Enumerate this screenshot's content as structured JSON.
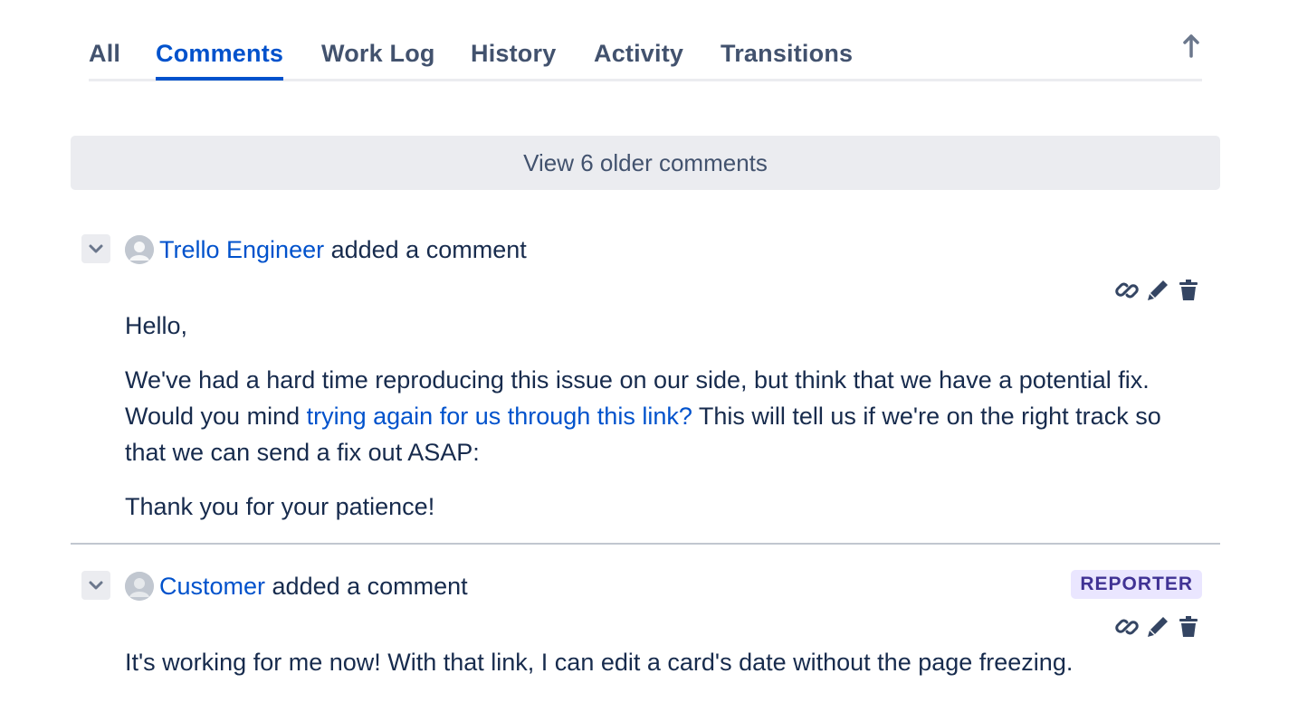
{
  "tabs": [
    {
      "label": "All",
      "active": false
    },
    {
      "label": "Comments",
      "active": true
    },
    {
      "label": "Work Log",
      "active": false
    },
    {
      "label": "History",
      "active": false
    },
    {
      "label": "Activity",
      "active": false
    },
    {
      "label": "Transitions",
      "active": false
    }
  ],
  "scroll_top_icon": "arrow-up-icon",
  "older_comments": {
    "label": "View 6 older comments"
  },
  "colors": {
    "accent": "#0052cc",
    "text": "#172b4d",
    "muted": "#42526e",
    "badge_bg": "#eae6ff",
    "badge_text": "#403294"
  },
  "comments": [
    {
      "author": "Trello Engineer",
      "action": " added a comment",
      "badge": null,
      "icons": [
        "link-icon",
        "pencil-icon",
        "trash-icon"
      ],
      "paragraphs": {
        "p1": "Hello,",
        "p2_before": "We've had a hard time reproducing this issue on our side, but think that we have a potential fix. Would you mind ",
        "p2_link": "trying again for us through this link?",
        "p2_after": " This will tell us if we're on the right track so that we can send a fix out ASAP:",
        "p3": "Thank you for your patience!"
      }
    },
    {
      "author": "Customer",
      "action": " added a comment",
      "badge": "REPORTER",
      "icons": [
        "link-icon",
        "pencil-icon",
        "trash-icon"
      ],
      "paragraphs": {
        "p1": "It's working for me now! With that link, I can edit a card's date without the page freezing."
      }
    }
  ]
}
